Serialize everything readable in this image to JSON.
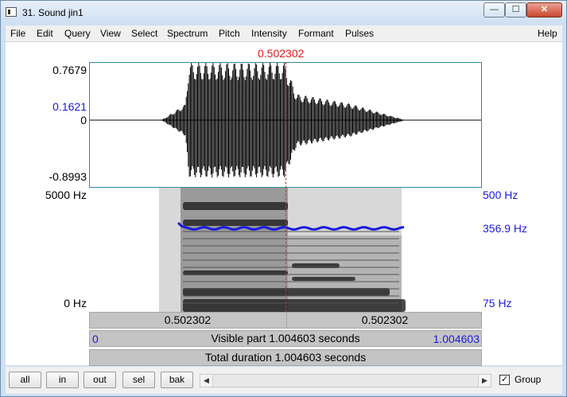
{
  "window": {
    "title": "31. Sound jin1",
    "min_label": "—",
    "max_label": "☐",
    "close_label": "✕"
  },
  "menu": [
    "File",
    "Edit",
    "Query",
    "View",
    "Select",
    "Spectrum",
    "Pitch",
    "Intensity",
    "Formant",
    "Pulses",
    "Help"
  ],
  "waveform": {
    "cursor_time": "0.502302",
    "y_max": "0.7679",
    "y_cursor": "0.1621",
    "y_zero": "0",
    "y_min": "-0.8993"
  },
  "spectrogram": {
    "freq_max": "5000 Hz",
    "freq_min": "0 Hz",
    "pitch_max": "500 Hz",
    "pitch_value": "356.9 Hz",
    "pitch_min": "75 Hz"
  },
  "time_bars": {
    "left_half": "0.502302",
    "right_half": "0.502302",
    "visible_start": "0",
    "visible_text": "Visible part 1.004603 seconds",
    "visible_end": "1.004603",
    "total_text": "Total duration 1.004603 seconds"
  },
  "bottom": {
    "buttons": [
      "all",
      "in",
      "out",
      "sel",
      "bak"
    ],
    "group_label": "Group",
    "group_checked": "✓"
  },
  "colors": {
    "cursor": "#e01a1a",
    "pitch": "#1a1ae0",
    "wave_border": "#2e8aa0"
  }
}
